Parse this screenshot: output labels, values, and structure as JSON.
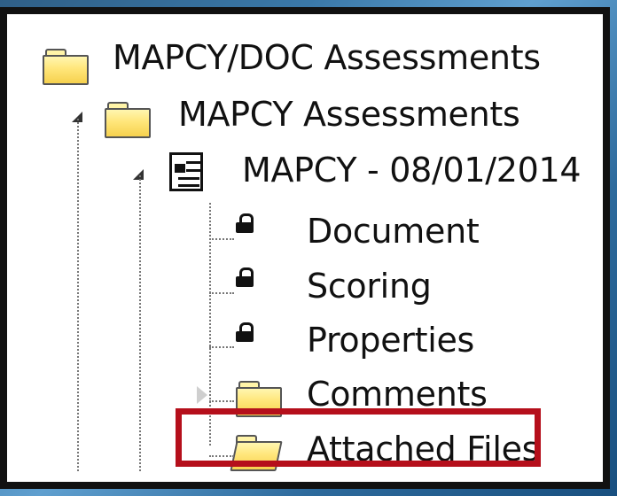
{
  "tree": {
    "root": {
      "label": "MAPCY/DOC Assessments",
      "icon": "folder-icon"
    },
    "child": {
      "label": "MAPCY Assessments",
      "icon": "folder-icon"
    },
    "assessment": {
      "label": "MAPCY - 08/01/2014",
      "icon": "document-lock-icon"
    },
    "items": [
      {
        "label": "Document",
        "icon": "lock-icon"
      },
      {
        "label": "Scoring",
        "icon": "lock-icon"
      },
      {
        "label": "Properties",
        "icon": "lock-icon"
      },
      {
        "label": "Comments",
        "icon": "folder-icon"
      },
      {
        "label": "Attached Files",
        "icon": "folder-open-icon"
      }
    ]
  },
  "colors": {
    "highlight": "#b50f1b",
    "folder_fill": "#ffe67a",
    "frame": "#111111",
    "background": "#3a78a8"
  }
}
